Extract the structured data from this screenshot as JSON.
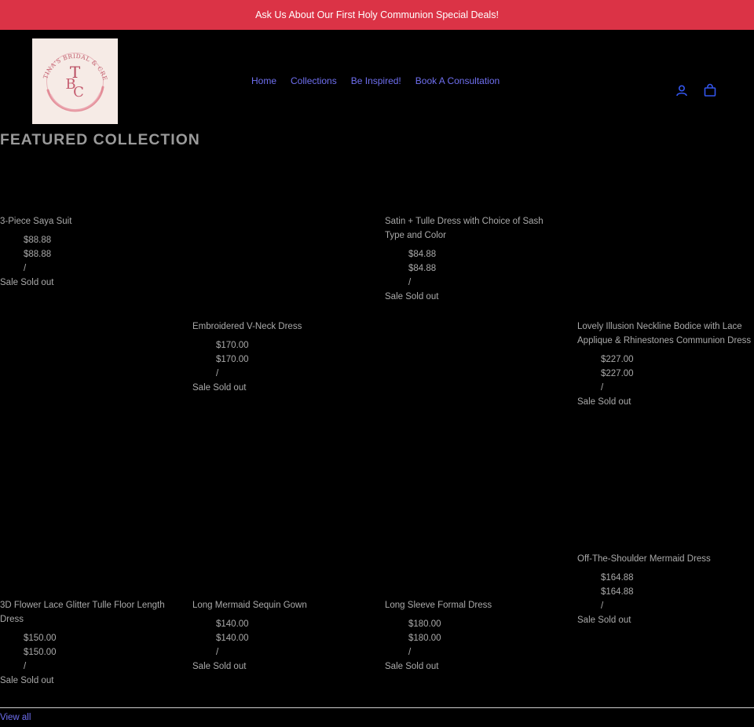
{
  "announcement": {
    "text": "Ask Us About Our First Holy Communion Special Deals!"
  },
  "logo": {
    "text": "TINA'S BRIDAL & CREATIONS",
    "monogram": "TBC"
  },
  "nav": {
    "items": [
      {
        "label": "Home"
      },
      {
        "label": "Collections"
      },
      {
        "label": "Be Inspired!"
      },
      {
        "label": "Book A Consultation"
      }
    ]
  },
  "header": {
    "account_icon": "user-icon",
    "cart_icon": "cart-icon"
  },
  "section": {
    "title": "FEATURED COLLECTION"
  },
  "products": [
    {
      "title": "3-Piece Saya Suit",
      "price_regular": "$88.88",
      "price_sale": "$88.88",
      "unit_sep": "/",
      "tags": "Sale Sold out"
    },
    {
      "title": "Satin + Tulle Dress with Choice of Sash Type and Color",
      "price_regular": "$84.88",
      "price_sale": "$84.88",
      "unit_sep": "/",
      "tags": "Sale Sold out"
    },
    {
      "title": "Embroidered V-Neck Dress",
      "price_regular": "$170.00",
      "price_sale": "$170.00",
      "unit_sep": "/",
      "tags": "Sale Sold out"
    },
    {
      "title": "Lovely Illusion Neckline Bodice with Lace Applique & Rhinestones Communion Dress",
      "price_regular": "$227.00",
      "price_sale": "$227.00",
      "unit_sep": "/",
      "tags": "Sale Sold out"
    },
    {
      "title": "Off-The-Shoulder Mermaid Dress",
      "price_regular": "$164.88",
      "price_sale": "$164.88",
      "unit_sep": "/",
      "tags": "Sale Sold out"
    },
    {
      "title": "3D Flower Lace Glitter Tulle Floor Length Dress",
      "price_regular": "$150.00",
      "price_sale": "$150.00",
      "unit_sep": "/",
      "tags": "Sale Sold out"
    },
    {
      "title": "Long Mermaid Sequin Gown",
      "price_regular": "$140.00",
      "price_sale": "$140.00",
      "unit_sep": "/",
      "tags": "Sale Sold out"
    },
    {
      "title": "Long Sleeve Formal Dress",
      "price_regular": "$180.00",
      "price_sale": "$180.00",
      "unit_sep": "/",
      "tags": "Sale Sold out"
    }
  ],
  "footer_link": {
    "label": "View all"
  },
  "colors": {
    "announcement_bg": "#db3346",
    "link": "#6f6ff0",
    "background": "#000000"
  }
}
